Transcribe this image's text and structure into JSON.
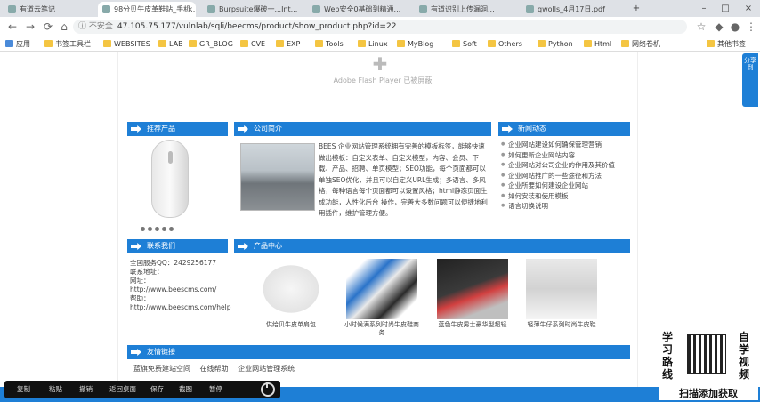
{
  "browser": {
    "tabs": [
      {
        "label": "有道云笔记"
      },
      {
        "label": "98分贝牛皮革鞋站_手机..."
      },
      {
        "label": "Burpsuite爆破一...Int..."
      },
      {
        "label": "Web安全0基础到精通..."
      },
      {
        "label": "有道识别上传漏洞..."
      },
      {
        "label": "qwolls_4月17日.pdf"
      }
    ],
    "url_status": "不安全",
    "url": "47.105.75.177/vulnlab/sqli/beecms/product/show_product.php?id=22",
    "bookmarks": [
      "应用",
      "书签工具栏",
      "WEBSITES",
      "LAB",
      "GR_BLOG",
      "CVE",
      "EXP",
      "Tools",
      "Linux",
      "MyBlog",
      "Soft",
      "Others",
      "Python",
      "Html",
      "网络卷机",
      "其他书签"
    ]
  },
  "page": {
    "flash_text": "Adobe Flash Player 已被屏蔽",
    "sections": {
      "recommend": "推荐产品",
      "company": "公司简介",
      "notice": "新闻动态",
      "contact": "联系我们",
      "products": "产品中心",
      "links": "友情链接"
    },
    "company_intro": "BEES 企业网站管理系统拥有完善的模板标签，能够快速做出模板：自定义表单、自定义模型，内容、会员、下载、产品、招聘、单页模型；SEO功能，每个页面都可以单独SEO优化，并且可以自定义URL生成；多语言、多风格，每种语言每个页面都可以设置风格；html静态页面生成功能，人性化后台 操作，完善大多数问题可以便捷地利用插件，维护管理方便。",
    "notice_items": [
      "企业网站建设如何确保管理营销",
      "如何更新企业网站内容",
      "企业网站对公司企业的作用及其价值",
      "企业网站推广的一些途径和方法",
      "企业所要如何建设企业网站",
      "如何安装和使用模板",
      "语言切换说明"
    ],
    "contact": {
      "qq_label": "全国服务QQ：",
      "qq": "2429256177",
      "email_label": "联系地址：",
      "site_label": "网址：",
      "site": "http://www.beescms.com/",
      "help_label": "帮助：",
      "help": "http://www.beescms.com/help"
    },
    "products": [
      {
        "caption": "供给贝牛皮单肩包"
      },
      {
        "caption": "小时候满系列时尚牛皮鞋商务"
      },
      {
        "caption": "蓝色牛皮男士豪华型超轻"
      },
      {
        "caption": "轻薄牛仔系列时尚牛皮鞋"
      }
    ],
    "friend_links": [
      "蓝旗免费建站空间",
      "在线帮助",
      "企业网站管理系统"
    ],
    "share_widget": "分享到"
  },
  "overlay": {
    "player_items": [
      "复制",
      "粘贴",
      "撤销",
      "返回桌面",
      "保存",
      "截图",
      "暂停"
    ],
    "promo_left": "学习路线",
    "promo_right": "自学视频",
    "promo_bottom": "扫描添加获取"
  }
}
